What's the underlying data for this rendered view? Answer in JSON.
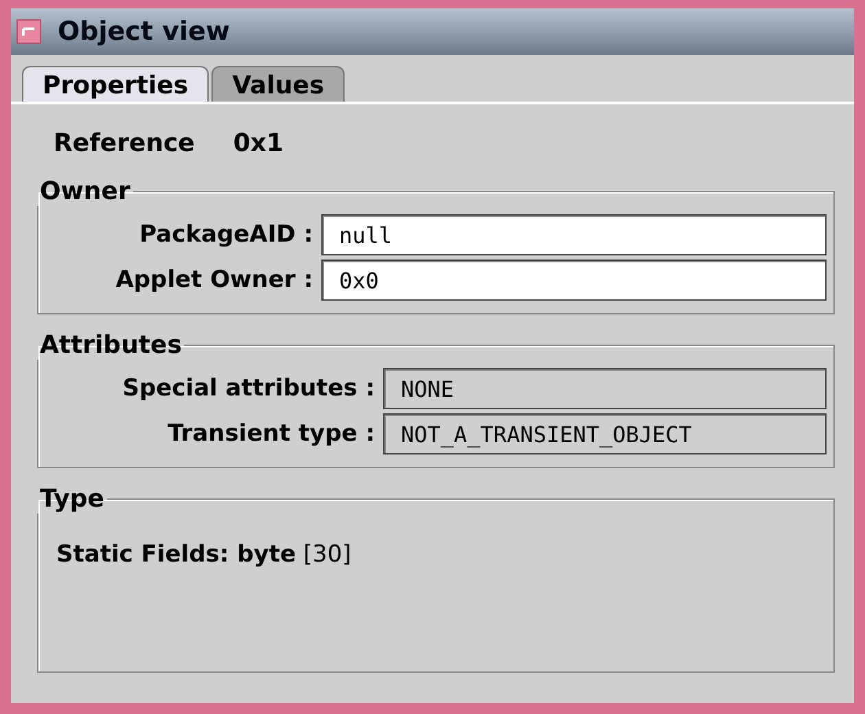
{
  "window": {
    "title": "Object view"
  },
  "tabs": [
    {
      "label": "Properties",
      "selected": true
    },
    {
      "label": "Values",
      "selected": false
    }
  ],
  "reference": {
    "label": "Reference",
    "value": "0x1"
  },
  "groups": [
    {
      "title": "Owner",
      "fields": [
        {
          "label": "PackageAID :",
          "value": "null",
          "editable": true
        },
        {
          "label": "Applet Owner :",
          "value": "0x0",
          "editable": true
        }
      ]
    },
    {
      "title": "Attributes",
      "fields": [
        {
          "label": "Special attributes :",
          "value": "NONE",
          "editable": false
        },
        {
          "label": "Transient type :",
          "value": "NOT_A_TRANSIENT_OBJECT",
          "editable": false
        }
      ]
    },
    {
      "title": "Type",
      "text": "**Static Fields: byte** [30]"
    }
  ]
}
